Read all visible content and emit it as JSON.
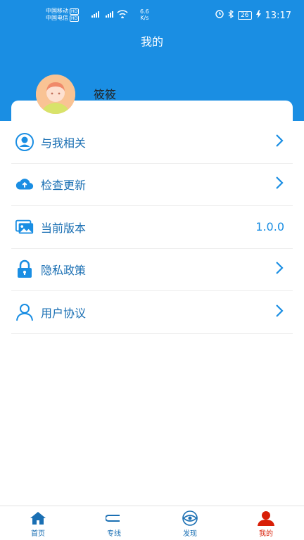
{
  "status_bar": {
    "carrier_1": "中国移动",
    "carrier_2": "中国电信",
    "hd": "HD",
    "speed_value": "6.6",
    "speed_unit": "K/s",
    "battery": "26",
    "time": "13:17"
  },
  "header": {
    "title": "我的"
  },
  "profile": {
    "name": "筱筱"
  },
  "menu": {
    "items": [
      {
        "label": "与我相关",
        "icon": "user-circle-icon",
        "right": ""
      },
      {
        "label": "检查更新",
        "icon": "cloud-upload-icon",
        "right": ""
      },
      {
        "label": "当前版本",
        "icon": "gallery-icon",
        "right": "1.0.0"
      },
      {
        "label": "隐私政策",
        "icon": "lock-icon",
        "right": ""
      },
      {
        "label": "用户协议",
        "icon": "user-icon",
        "right": ""
      }
    ]
  },
  "tabbar": {
    "tabs": [
      {
        "label": "首页",
        "icon": "home-icon",
        "active": false
      },
      {
        "label": "专线",
        "icon": "route-icon",
        "active": false
      },
      {
        "label": "发现",
        "icon": "eye-icon",
        "active": false
      },
      {
        "label": "我的",
        "icon": "profile-icon",
        "active": true
      }
    ]
  },
  "colors": {
    "primary": "#1a8ee3",
    "active": "#d81e06"
  }
}
